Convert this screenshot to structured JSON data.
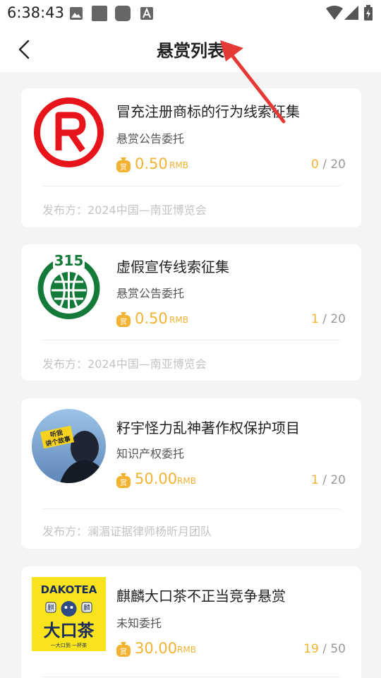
{
  "status_bar": {
    "time": "6:38:43"
  },
  "header": {
    "title": "悬赏列表"
  },
  "cards": [
    {
      "title": "冒充注册商标的行为线索征集",
      "category": "悬赏公告委托",
      "reward": "0.50",
      "unit": "RMB",
      "taken": "0",
      "total": "20",
      "publisher_label": "发布方：",
      "publisher": "2024中国—南亚博览会"
    },
    {
      "title": "虚假宣传线索征集",
      "category": "悬赏公告委托",
      "reward": "0.50",
      "unit": "RMB",
      "taken": "1",
      "total": "20",
      "publisher_label": "发布方：",
      "publisher": "2024中国—南亚博览会"
    },
    {
      "title": "籽宇怪力乱神著作权保护项目",
      "category": "知识产权委托",
      "reward": "50.00",
      "unit": "RMB",
      "taken": "1",
      "total": "20",
      "publisher_label": "发布方：",
      "publisher": "澜湄证据律师杨昕月团队",
      "image_text": [
        "听我",
        "讲个故事"
      ]
    },
    {
      "title": "麒麟大口茶不正当竞争悬赏",
      "category": "未知委托",
      "reward": "30.00",
      "unit": "RMB",
      "taken": "19",
      "total": "50",
      "image_text": [
        "DAKOTEA",
        "大口茶",
        "麒",
        "麟",
        "一大口到 一杯茶"
      ]
    }
  ],
  "colors": {
    "accent": "#f2b232",
    "registered_red": "#e8141b",
    "cn315_green": "#137a3a",
    "annotation_red": "#e53935"
  }
}
